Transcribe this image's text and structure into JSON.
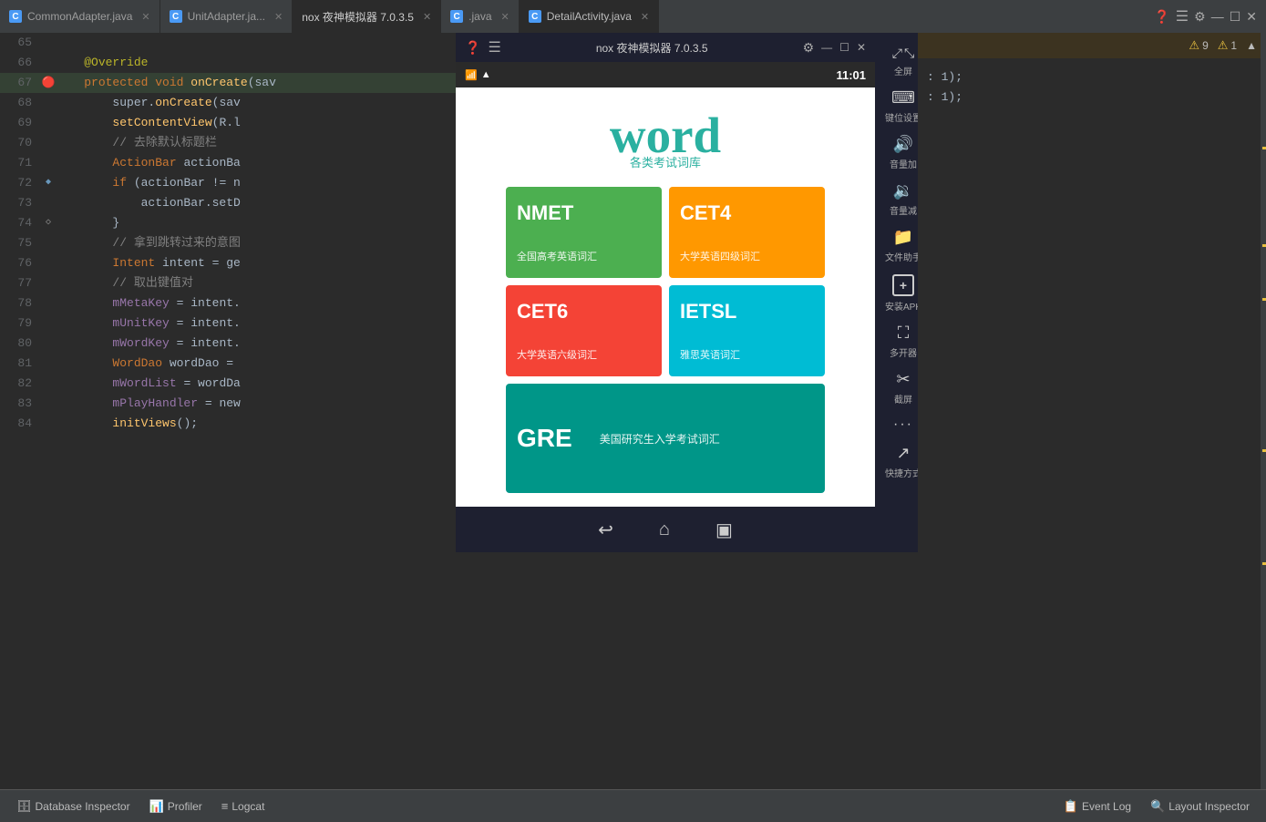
{
  "tabs": [
    {
      "id": "common-adapter",
      "label": "CommonAdapter.java",
      "icon_type": "blue",
      "icon_text": "C",
      "active": false
    },
    {
      "id": "unit-adapter",
      "label": "UnitAdapter.ja...",
      "icon_type": "blue",
      "icon_text": "C",
      "active": false
    },
    {
      "id": "emulator-tab",
      "label": "nox 夜神模拟器 7.0.3.5",
      "icon_type": "",
      "icon_text": "",
      "active": false
    },
    {
      "id": "java-tab",
      "label": ".java",
      "icon_type": "blue",
      "icon_text": "C",
      "active": false
    },
    {
      "id": "detail-activity",
      "label": "DetailActivity.java",
      "icon_type": "blue",
      "icon_text": "C",
      "active": true
    }
  ],
  "emulator": {
    "title": "nox 夜神模拟器 7.0.3.5",
    "status_time": "11:01",
    "logo_word": "word",
    "logo_subtitle": "各类考试词库",
    "buttons": [
      {
        "id": "nmet",
        "title": "NMET",
        "subtitle": "全国高考英语词汇",
        "color": "#4caf50"
      },
      {
        "id": "cet4",
        "title": "CET4",
        "subtitle": "大学英语四级词汇",
        "color": "#ff9800"
      },
      {
        "id": "cet6",
        "title": "CET6",
        "subtitle": "大学英语六级词汇",
        "color": "#f44336"
      },
      {
        "id": "ietsl",
        "title": "IETSL",
        "subtitle": "雅思英语词汇",
        "color": "#00bcd4"
      },
      {
        "id": "gre",
        "title": "GRE",
        "subtitle": "美国研究生入学考试词汇",
        "color": "#009688",
        "wide": true
      }
    ],
    "sidebar_buttons": [
      {
        "id": "fullscreen",
        "icon": "⤢",
        "label": "全屏"
      },
      {
        "id": "keybind",
        "icon": "⌨",
        "label": "键位设置"
      },
      {
        "id": "vol-up",
        "icon": "🔊",
        "label": "音量加"
      },
      {
        "id": "vol-down",
        "icon": "🔉",
        "label": "音量减"
      },
      {
        "id": "file-helper",
        "icon": "📁",
        "label": "文件助手"
      },
      {
        "id": "install-apk",
        "icon": "+",
        "label": "安装APK"
      },
      {
        "id": "multi-open",
        "icon": "⛶",
        "label": "多开器"
      },
      {
        "id": "screenshot",
        "icon": "✂",
        "label": "截屏"
      },
      {
        "id": "more",
        "icon": "...",
        "label": ""
      },
      {
        "id": "shortcut",
        "icon": "↗",
        "label": "快捷方式"
      }
    ],
    "bottom_controls": [
      "↩",
      "⌂",
      "▣"
    ]
  },
  "code_lines": [
    {
      "num": "65",
      "content": "",
      "type": "plain"
    },
    {
      "num": "66",
      "content": "    @Override",
      "type": "override"
    },
    {
      "num": "67",
      "content": "    protected void onCreate(sav",
      "type": "method",
      "has_arrow": true,
      "has_bookmark": true
    },
    {
      "num": "68",
      "content": "        super.onCreate(sav",
      "type": "code"
    },
    {
      "num": "69",
      "content": "        setContentView(R.l",
      "type": "code"
    },
    {
      "num": "70",
      "content": "        // 去除默认标题栏",
      "type": "comment"
    },
    {
      "num": "71",
      "content": "        ActionBar actionBa",
      "type": "code"
    },
    {
      "num": "72",
      "content": "        if (actionBar != n",
      "type": "code",
      "has_bookmark": true
    },
    {
      "num": "73",
      "content": "            actionBar.setD",
      "type": "code"
    },
    {
      "num": "74",
      "content": "        }",
      "type": "code",
      "has_bookmark_light": true
    },
    {
      "num": "75",
      "content": "        // 拿到跳转过来的意图",
      "type": "comment"
    },
    {
      "num": "76",
      "content": "        Intent intent = ge",
      "type": "code"
    },
    {
      "num": "77",
      "content": "        // 取出键值对",
      "type": "comment"
    },
    {
      "num": "78",
      "content": "        mMetaKey = intent.",
      "type": "code_purple"
    },
    {
      "num": "79",
      "content": "        mUnitKey = intent.",
      "type": "code_purple"
    },
    {
      "num": "80",
      "content": "        mWordKey = intent.",
      "type": "code_purple"
    },
    {
      "num": "81",
      "content": "        WordDao wordDao = ",
      "type": "code"
    },
    {
      "num": "82",
      "content": "        mWordList = wordDa",
      "type": "code_purple"
    },
    {
      "num": "83",
      "content": "        mPlayHandler = new",
      "type": "code_purple"
    },
    {
      "num": "84",
      "content": "        initViews();",
      "type": "code"
    }
  ],
  "right_code": {
    "warnings": {
      "count1": "9",
      "count2": "1",
      "label1": "⚠",
      "label2": "⚠"
    },
    "lines": [
      {
        "content": ": 1);"
      },
      {
        "content": ": 1);"
      }
    ]
  },
  "status_bar": {
    "items": [
      {
        "id": "database-inspector",
        "label": "Database Inspector",
        "icon": "🗄"
      },
      {
        "id": "profiler",
        "label": "Profiler",
        "icon": "📊"
      },
      {
        "id": "logcat",
        "label": "Logcat",
        "icon": "≡"
      },
      {
        "id": "event-log",
        "label": "Event Log",
        "icon": "📋"
      },
      {
        "id": "layout-inspector",
        "label": "Layout Inspector",
        "icon": "🔍"
      }
    ]
  }
}
